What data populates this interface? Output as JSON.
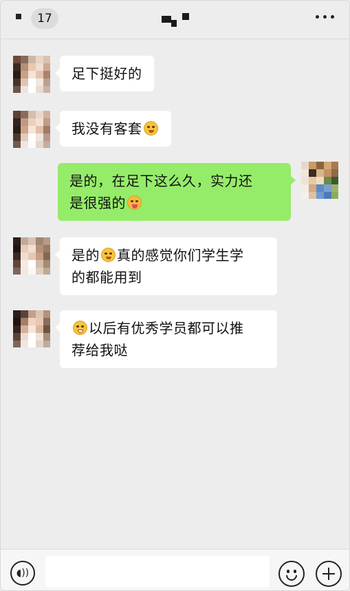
{
  "header": {
    "unread_count": "17"
  },
  "messages": [
    {
      "side": "left",
      "text": "足下挺好的"
    },
    {
      "side": "left",
      "text": "我没有客套",
      "emoji": "pleading-face-emoji"
    },
    {
      "side": "right",
      "line1": "是的，在足下这么久，实力还",
      "line2": "是很强的",
      "emoji": "tongue-wink-emoji"
    },
    {
      "side": "left",
      "line1a": "是的",
      "line1b": "真的感觉你们学生学",
      "line2": "的都能用到",
      "emoji": "smiling-face-emoji"
    },
    {
      "side": "left",
      "line1": "以后有优秀学员都可以推",
      "line2": "荐给我哒",
      "emoji": "grinning-face-emoji"
    }
  ],
  "input": {
    "value": "",
    "placeholder": ""
  },
  "colors": {
    "background": "#ededed",
    "incoming_bubble": "#ffffff",
    "outgoing_bubble": "#95ec69"
  }
}
